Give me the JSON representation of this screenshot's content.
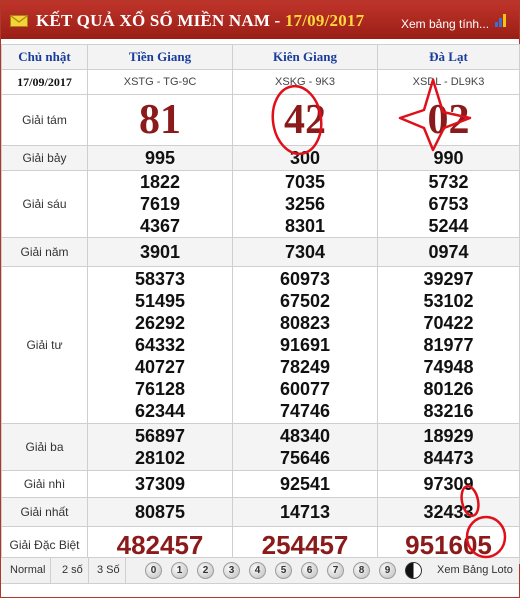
{
  "header": {
    "title": "KẾT QUẢ XỔ SỐ MIỀN NAM - ",
    "date": "17/09/2017",
    "view_all": "Xem bảng tính..."
  },
  "table": {
    "day": "Chủ nhật",
    "date": "17/09/2017",
    "provinces": [
      {
        "name": "Tiền Giang",
        "code": "XSTG - TG-9C"
      },
      {
        "name": "Kiên Giang",
        "code": "XSKG - 9K3"
      },
      {
        "name": "Đà Lạt",
        "code": "XSDL - DL9K3"
      }
    ],
    "prizes": {
      "g8": {
        "label": "Giải tám",
        "values": [
          "81",
          "42",
          "02"
        ]
      },
      "g7": {
        "label": "Giải bảy",
        "values": [
          "995",
          "300",
          "990"
        ]
      },
      "g6": {
        "label": "Giải sáu",
        "values": [
          [
            "1822",
            "7619",
            "4367"
          ],
          [
            "7035",
            "3256",
            "8301"
          ],
          [
            "5732",
            "6753",
            "5244"
          ]
        ]
      },
      "g5": {
        "label": "Giải năm",
        "values": [
          "3901",
          "7304",
          "0974"
        ]
      },
      "g4": {
        "label": "Giải tư",
        "values": [
          [
            "58373",
            "51495",
            "26292",
            "64332",
            "40727",
            "76128",
            "62344"
          ],
          [
            "60973",
            "67502",
            "80823",
            "91691",
            "78249",
            "60077",
            "74746"
          ],
          [
            "39297",
            "53102",
            "70422",
            "81977",
            "74948",
            "80126",
            "83216"
          ]
        ]
      },
      "g3": {
        "label": "Giải ba",
        "values": [
          [
            "56897",
            "28102"
          ],
          [
            "48340",
            "75646"
          ],
          [
            "18929",
            "84473"
          ]
        ]
      },
      "g2": {
        "label": "Giải nhì",
        "values": [
          "37309",
          "92541",
          "97309"
        ]
      },
      "g1": {
        "label": "Giải nhất",
        "values": [
          "80875",
          "14713",
          "32433"
        ]
      },
      "db": {
        "label": "Giải Đặc Biệt",
        "values": [
          "482457",
          "254457",
          "951605"
        ]
      }
    }
  },
  "footer": {
    "modes": [
      "Normal",
      "2 số",
      "3 Số"
    ],
    "digits": [
      "0",
      "1",
      "2",
      "3",
      "4",
      "5",
      "6",
      "7",
      "8",
      "9"
    ],
    "view_loto": "Xem Bảng Loto"
  },
  "colors": {
    "header_bg": "#b32a20",
    "header_date": "#ffd83a",
    "province_text": "#1a3c9c",
    "special_text": "#8b1a1a",
    "annotation": "#e0101a"
  },
  "icons": [
    "envelope-icon",
    "signal-bars-icon",
    "yin-yang-icon"
  ]
}
